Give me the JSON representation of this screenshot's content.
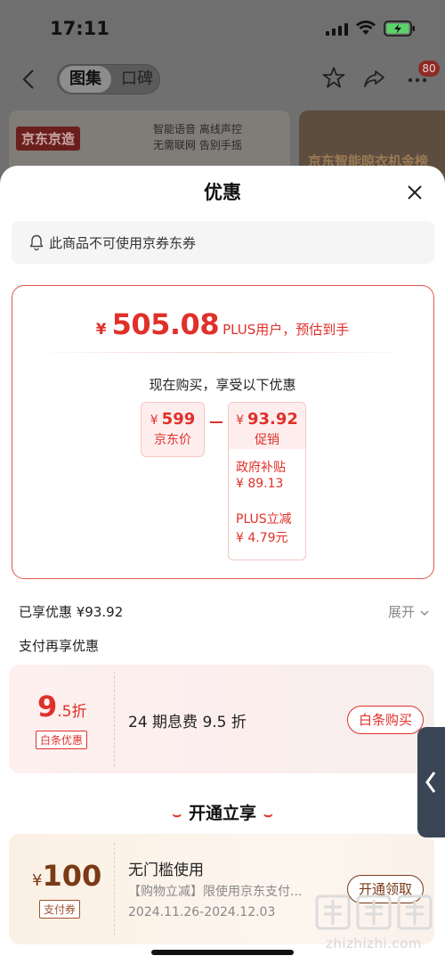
{
  "status_bar": {
    "time": "17:11"
  },
  "top_nav": {
    "tabs": [
      "图集",
      "口碑"
    ],
    "active_tab": "图集",
    "badge_count": "80"
  },
  "banners": {
    "left_logo": "京东京造",
    "left_lines": [
      "智能语音  离线声控",
      "无需联网  告别手摇"
    ],
    "right_text": "京东智能晾衣机金榜"
  },
  "sheet": {
    "title": "优惠",
    "notice": "此商品不可使用京券东券",
    "final_price": {
      "currency": "¥",
      "value": "505.08",
      "note": "PLUS用户，预估到手"
    },
    "purchase_note": "现在购买，享受以下优惠",
    "jd_price": {
      "currency": "¥",
      "value": "599",
      "label": "京东价"
    },
    "promotion": {
      "currency": "¥",
      "value": "93.92",
      "label": "促销",
      "items": [
        {
          "title": "政府补贴",
          "value": "¥ 89.13"
        },
        {
          "title": "PLUS立减",
          "value": "¥ 4.79元"
        }
      ]
    },
    "enjoyed": "已享优惠 ¥93.92",
    "expand_label": "展开",
    "pay_more": "支付再享优惠",
    "baitiao": {
      "discount_big": "9",
      "discount_small": ".5折",
      "tag": "白条优惠",
      "desc": "24 期息费 9.5 折",
      "button": "白条购买"
    },
    "open_title": "开通立享",
    "pay_coupon": {
      "currency": "¥",
      "amount": "100",
      "tag": "支付券",
      "title": "无门槛使用",
      "desc": "【购物立减】限使用京东支付...",
      "date": "2024.11.26-2024.12.03",
      "button": "开通领取"
    }
  },
  "watermark": {
    "text": "zhizhizhi.com"
  },
  "colors": {
    "accent": "#e0302a",
    "coupon_brown": "#7a3a16"
  }
}
